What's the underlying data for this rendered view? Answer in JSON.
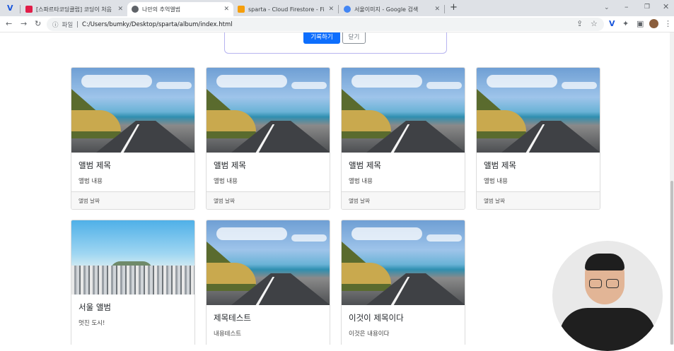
{
  "browser": {
    "tabs": [
      {
        "title": "[스파르타코딩클럽] 코딩이 처음",
        "favicon_color": "#e11d48",
        "active": false
      },
      {
        "title": "나만의 추억앨범",
        "favicon_color": "#5f6368",
        "active": true
      },
      {
        "title": "sparta - Cloud Firestore - Fireba",
        "favicon_color": "#f59e0b",
        "active": false
      },
      {
        "title": "서울이미지 - Google 검색",
        "favicon_color": "#4285f4",
        "active": false
      }
    ],
    "new_tab": "+",
    "address_prefix": "파일",
    "url": "C:/Users/bumky/Desktop/sparta/album/index.html"
  },
  "form": {
    "save_label": "기록하기",
    "close_label": "닫기"
  },
  "cards": [
    {
      "title": "앨범 제목",
      "text": "앨범 내용",
      "date": "앨범 날짜",
      "image": "road"
    },
    {
      "title": "앨범 제목",
      "text": "앨범 내용",
      "date": "앨범 날짜",
      "image": "road"
    },
    {
      "title": "앨범 제목",
      "text": "앨범 내용",
      "date": "앨범 날짜",
      "image": "road"
    },
    {
      "title": "앨범 제목",
      "text": "앨범 내용",
      "date": "앨범 날짜",
      "image": "road"
    },
    {
      "title": "서울 앨범",
      "text": "멋진 도시!",
      "image": "city"
    },
    {
      "title": "제목테스트",
      "text": "내용테스트",
      "image": "road"
    },
    {
      "title": "이것이 제목이다",
      "text": "이것은 내용이다",
      "image": "road"
    }
  ],
  "colors": {
    "primary": "#0d6efd",
    "tabbar": "#dee1e6"
  }
}
